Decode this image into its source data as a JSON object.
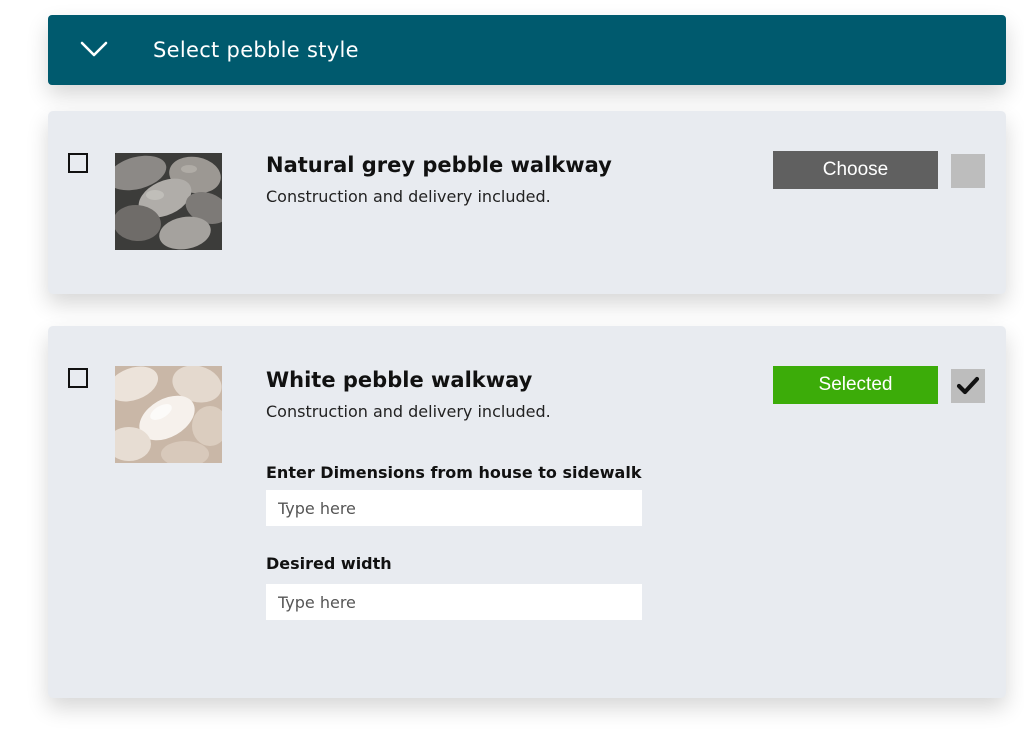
{
  "header": {
    "title": "Select pebble style",
    "icon": "chevron-down-icon",
    "color": "#005a6e"
  },
  "options": [
    {
      "name": "Natural grey pebble walkway",
      "description": "Construction and delivery included.",
      "button_label": "Choose",
      "button_color": "#606060",
      "selected": false,
      "image": "grey-pebbles-image"
    },
    {
      "name": "White pebble walkway",
      "description": "Construction and delivery included.",
      "button_label": "Selected",
      "button_color": "#3cac09",
      "selected": true,
      "image": "white-pebbles-image",
      "fields": [
        {
          "label": "Enter Dimensions from house to sidewalk",
          "placeholder": "Type here",
          "value": ""
        },
        {
          "label": "Desired width",
          "placeholder": "Type here",
          "value": ""
        }
      ]
    }
  ]
}
